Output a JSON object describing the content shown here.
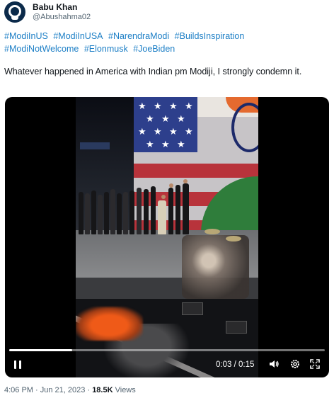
{
  "tweet": {
    "display_name": "Babu Khan",
    "handle": "@Abushahma02",
    "hashtags": [
      "#ModiInUS",
      "#ModiInUSA",
      "#NarendraModi",
      "#BuildsInspiration",
      "#ModiNotWelcome",
      "#Elonmusk",
      "#JoeBiden"
    ],
    "text": "Whatever happened in America with Indian pm Modiji, I strongly condemn it.",
    "time": "4:06 PM",
    "separator": "·",
    "date": "Jun 21, 2023",
    "views_count": "18.5K",
    "views_label": "Views"
  },
  "video": {
    "current_time": "0:03",
    "time_separator": "/",
    "duration": "0:15",
    "progress_fraction": 0.2,
    "controls": [
      "pause-icon",
      "volume-icon",
      "settings-gear-icon",
      "fullscreen-icon"
    ]
  },
  "colors": {
    "link": "#1d7fc6",
    "secondary_text": "#536471",
    "primary_text": "#0f1419"
  }
}
